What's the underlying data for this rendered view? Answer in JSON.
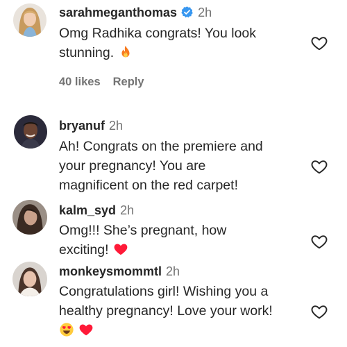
{
  "comments": [
    {
      "username": "sarahmeganthomas",
      "verified": true,
      "time": "2h",
      "lines": [
        "Omg Radhika congrats! You look",
        "stunning."
      ],
      "emojis": [
        "fire-icon"
      ],
      "likes": "40 likes",
      "reply": "Reply"
    },
    {
      "username": "bryanuf",
      "verified": false,
      "time": "2h",
      "lines": [
        "Ah! Congrats on the premiere and",
        "your pregnancy! You are",
        "magnificent on the red carpet!"
      ],
      "emojis": []
    },
    {
      "username": "kalm_syd",
      "verified": false,
      "time": "2h",
      "lines": [
        "Omg!!! She’s pregnant, how",
        "exciting!"
      ],
      "emojis": [
        "red-heart-icon"
      ]
    },
    {
      "username": "monkeysmommtl",
      "verified": false,
      "time": "2h",
      "lines": [
        "Congratulations girl! Wishing you a",
        "healthy pregnancy! Love your work!"
      ],
      "emojis": [
        "heart-eyes-emoji-icon",
        "red-heart-icon"
      ]
    }
  ],
  "colors": {
    "username": "#262626",
    "meta": "#737373",
    "verified_badge": "#3897f0",
    "heart_outline": "#262626",
    "red_heart": "#ff1a38"
  }
}
